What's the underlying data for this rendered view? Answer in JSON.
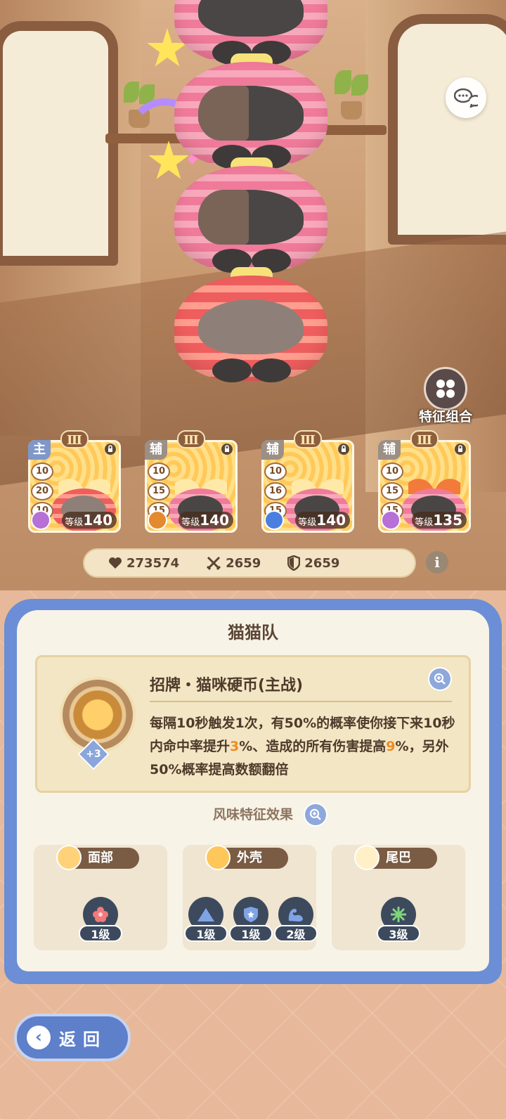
{
  "colors": {
    "accent": "#6b8ed6",
    "highlight": "#f08b1f",
    "panel_bg": "#f8f3e7",
    "brown": "#7a5b43"
  },
  "top": {
    "chat_icon": "chat-bubbles-icon",
    "feature_combo_label": "特征组合"
  },
  "team": [
    {
      "role": "主",
      "tier": "Ⅲ",
      "stats": [
        "10",
        "20",
        "10"
      ],
      "level_label": "等级",
      "level": "140"
    },
    {
      "role": "辅",
      "tier": "Ⅲ",
      "stats": [
        "10",
        "15",
        "15"
      ],
      "level_label": "等级",
      "level": "140"
    },
    {
      "role": "辅",
      "tier": "Ⅲ",
      "stats": [
        "10",
        "16",
        "15"
      ],
      "level_label": "等级",
      "level": "140"
    },
    {
      "role": "辅",
      "tier": "Ⅲ",
      "stats": [
        "10",
        "15",
        "15"
      ],
      "level_label": "等级",
      "level": "135"
    }
  ],
  "stats": {
    "hp": "273574",
    "attack": "2659",
    "defense": "2659"
  },
  "panel": {
    "title": "猫猫队",
    "skill": {
      "name": "招牌・猫咪硬币(主战)",
      "plus": "+3",
      "desc_1": "每隔10秒触发1次，有50%的概率使你接下来10秒内命中率提升",
      "desc_hl1": "3",
      "desc_2": "%、造成的所有伤害提高",
      "desc_hl2": "9",
      "desc_3": "%，另外50%概率提高数额翻倍"
    },
    "section_title": "风味特征效果",
    "traits": [
      {
        "name": "面部",
        "items": [
          {
            "icon": "flower-icon",
            "level": "1级"
          }
        ]
      },
      {
        "name": "外壳",
        "items": [
          {
            "icon": "mountain-icon",
            "level": "1级"
          },
          {
            "icon": "shield-icon",
            "level": "1级"
          },
          {
            "icon": "muscle-icon",
            "level": "2级"
          }
        ]
      },
      {
        "name": "尾巴",
        "items": [
          {
            "icon": "snowflake-icon",
            "level": "3级"
          }
        ]
      }
    ]
  },
  "back_label": "返回"
}
